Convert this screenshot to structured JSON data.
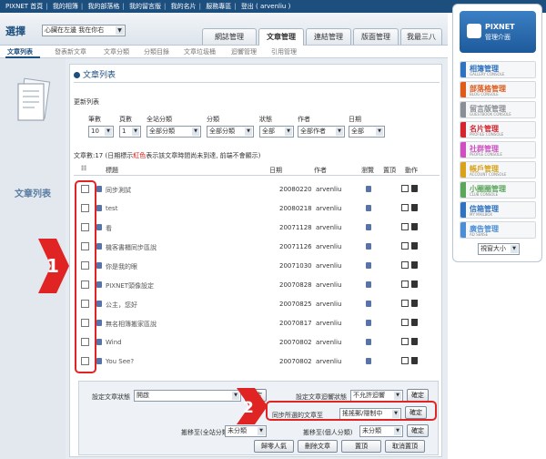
{
  "topbar": {
    "items": [
      "PIXNET 首頁",
      "我的相簿",
      "我的部落格",
      "我的留言版",
      "我的名片",
      "服務專區",
      "登出 ( arvenliu )"
    ]
  },
  "blogbar": {
    "select_label": "選擇",
    "blog_value": "心臟在左邊 我在你右",
    "tabs": [
      "網誌管理",
      "文章管理",
      "連結管理",
      "版面管理",
      "我最三八"
    ],
    "active_tab": "文章管理"
  },
  "subtabs": [
    "文章列表",
    "發表新文章",
    "文章分類",
    "分類目錄",
    "文章垃圾桶",
    "迴響管理",
    "引用管理"
  ],
  "leftcol": {
    "title": "文章列表"
  },
  "content": {
    "title": "文章列表",
    "update_list": "更新列表",
    "filters": {
      "labels": [
        "筆數",
        "頁數",
        "全站分類",
        "分類",
        "狀態",
        "作者",
        "日期"
      ],
      "values": [
        "10",
        "1",
        "全部分類",
        "全部分類",
        "全部",
        "全部作者",
        "全部"
      ]
    },
    "count_prefix": "文章數:17 (日期標示",
    "count_red": "紅色",
    "count_suffix": "表示該文章時間尚未到達, 前端不會顯示)",
    "table_headers": {
      "title": "標題",
      "date": "日期",
      "author": "作者",
      "browse": "瀏覽",
      "pin": "置頂",
      "action": "動作"
    },
    "rows": [
      {
        "title": "同步測試",
        "date": "20080220",
        "author": "arvenliu"
      },
      {
        "title": "test",
        "date": "20080218",
        "author": "arvenliu"
      },
      {
        "title": "看",
        "date": "20071128",
        "author": "arvenliu"
      },
      {
        "title": "機客書櫃同步區說",
        "date": "20071126",
        "author": "arvenliu"
      },
      {
        "title": "你是我的眼",
        "date": "20071030",
        "author": "arvenliu"
      },
      {
        "title": "PIXNET頭像設定",
        "date": "20070828",
        "author": "arvenliu"
      },
      {
        "title": "公主，您好",
        "date": "20070825",
        "author": "arvenliu"
      },
      {
        "title": "無名相簿搬家區說",
        "date": "20070817",
        "author": "arvenliu"
      },
      {
        "title": "Wind",
        "date": "20070802",
        "author": "arvenliu"
      },
      {
        "title": "You See?",
        "date": "20070802",
        "author": "arvenliu"
      }
    ]
  },
  "actions": {
    "status_label": "設定文章狀態",
    "status_value": "開啟",
    "confirm": "確定",
    "comment_label": "設定文章迴響狀態",
    "comment_value": "不允許迴響",
    "sync_label": "同步所選的文章至",
    "sync_value": "搖搖郵/隱制中",
    "move_site_label": "搬移至(全站分類)",
    "move_site_value": "未分類",
    "move_personal_label": "搬移至(個人分類)",
    "move_personal_value": "未分類",
    "bottom_buttons": [
      "歸零人氣",
      "刪除文章",
      "置頂",
      "取消置頂"
    ]
  },
  "annotations": {
    "marker_1": "1",
    "marker_2": "2"
  },
  "console": {
    "logo_name": "PIXNET",
    "logo_sub": "管理介面",
    "items": [
      {
        "name": "相簿管理",
        "sub": "GALLERY CONSOLE",
        "color": "#2f72c0"
      },
      {
        "name": "部落格管理",
        "sub": "BLOG CONSOLE",
        "color": "#e05a1a"
      },
      {
        "name": "留言版管理",
        "sub": "GUESTBOOK CONSOLE",
        "color": "#8a8f96"
      },
      {
        "name": "名片管理",
        "sub": "PROFILE CONSOLE",
        "color": "#d6242e"
      },
      {
        "name": "社群管理",
        "sub": "PEOPLE CONSOLE",
        "color": "#cf4fc2"
      },
      {
        "name": "帳戶管理",
        "sub": "ACCOUNT CONSOLE",
        "color": "#d9a218"
      },
      {
        "name": "小圈圈管理",
        "sub": "CLUB CONSOLE",
        "color": "#5aa65a"
      },
      {
        "name": "信箱管理",
        "sub": "MY MAILBOX",
        "color": "#2f72c0"
      },
      {
        "name": "廣告管理",
        "sub": "AD SENSE",
        "color": "#4c8ed6"
      }
    ],
    "window_size": "視窗大小"
  }
}
